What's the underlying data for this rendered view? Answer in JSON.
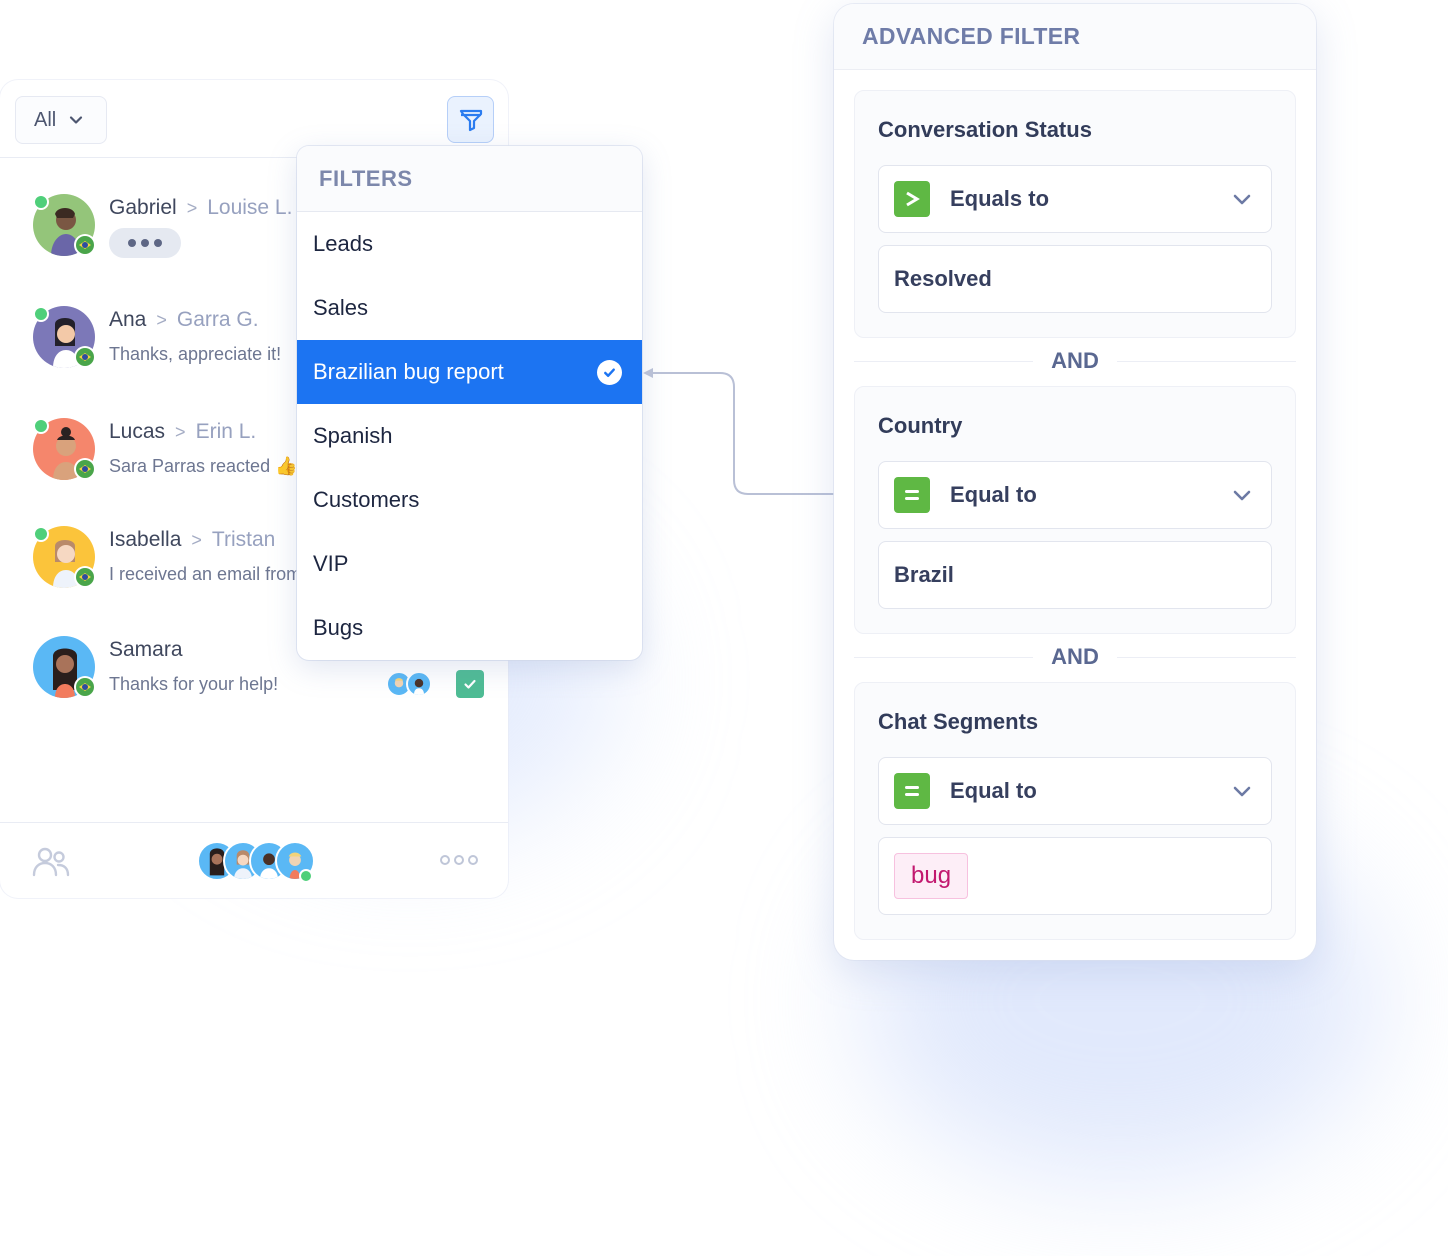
{
  "inbox": {
    "view_dropdown": {
      "label": "All"
    },
    "conversations": [
      {
        "name": "Gabriel",
        "agent": "Louise L.",
        "preview": "",
        "typing": true,
        "online": true,
        "country": "Brazil",
        "avatar_color": "#94c57a"
      },
      {
        "name": "Ana",
        "agent": "Garra G.",
        "preview": "Thanks, appreciate it!",
        "typing": false,
        "online": true,
        "country": "Brazil",
        "avatar_color": "#7c78b8"
      },
      {
        "name": "Lucas",
        "agent": "Erin L.",
        "preview": "Sara Parras reacted 👍",
        "typing": false,
        "online": true,
        "country": "Brazil",
        "avatar_color": "#f5866c"
      },
      {
        "name": "Isabella",
        "agent": "Tristan",
        "preview": "I received an email from",
        "typing": false,
        "online": true,
        "country": "Brazil",
        "avatar_color": "#fbc43b"
      },
      {
        "name": "Samara",
        "agent": "",
        "preview": "Thanks for your help!",
        "typing": false,
        "online": false,
        "country": "Brazil",
        "avatar_color": "#5ab8f5",
        "status": "resolved"
      }
    ],
    "footer": {
      "online_agents_count": 4
    }
  },
  "filters": {
    "title": "FILTERS",
    "items": [
      {
        "label": "Leads",
        "selected": false
      },
      {
        "label": "Sales",
        "selected": false
      },
      {
        "label": "Brazilian bug report",
        "selected": true
      },
      {
        "label": "Spanish",
        "selected": false
      },
      {
        "label": "Customers",
        "selected": false
      },
      {
        "label": "VIP",
        "selected": false
      },
      {
        "label": "Bugs",
        "selected": false
      }
    ]
  },
  "advanced_filter": {
    "title": "ADVANCED FILTER",
    "conjunction": "AND",
    "conditions": [
      {
        "field": "Conversation Status",
        "operator": "Equals to",
        "operator_icon": "greater-than-icon",
        "value": "Resolved"
      },
      {
        "field": "Country",
        "operator": "Equal to",
        "operator_icon": "equals-icon",
        "value": "Brazil"
      },
      {
        "field": "Chat Segments",
        "operator": "Equal to",
        "operator_icon": "equals-icon",
        "value_tag": "bug"
      }
    ]
  },
  "colors": {
    "accent": "#1c74f2",
    "operator_green": "#5fb844",
    "online": "#4fcf7a",
    "resolved": "#4ebc94",
    "tag_text": "#c2186f"
  }
}
